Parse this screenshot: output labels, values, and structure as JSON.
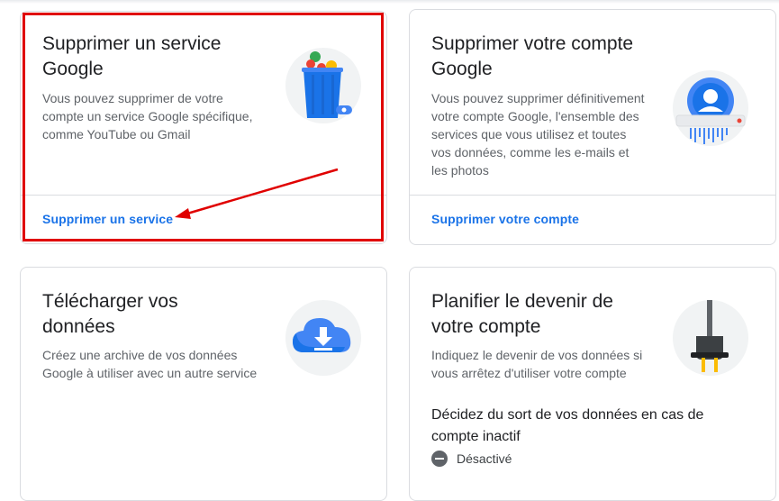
{
  "cards": {
    "delete_service": {
      "title_line1": "Supprimer un service",
      "title_line2": "Google",
      "desc_line1": "Vous pouvez supprimer de votre",
      "desc_line2": "compte un service Google spécifique,",
      "desc_line3": "comme YouTube ou Gmail",
      "link": "Supprimer un service",
      "icon": "trash-bin-icon"
    },
    "delete_account": {
      "title_line1": "Supprimer votre compte",
      "title_line2": "Google",
      "desc_line1": "Vous pouvez supprimer définitivement",
      "desc_line2": "votre compte Google, l'ensemble des",
      "desc_line3": "services que vous utilisez et toutes",
      "desc_line4": "vos données, comme les e-mails et",
      "desc_line5": "les photos",
      "link": "Supprimer votre compte",
      "icon": "account-shredder-icon"
    },
    "download_data": {
      "title_line1": "Télécharger vos",
      "title_line2": "données",
      "desc_line1": "Créez une archive de vos données",
      "desc_line2": "Google à utiliser avec un autre service",
      "icon": "cloud-download-icon"
    },
    "plan_account": {
      "title_line1": "Planifier le devenir de",
      "title_line2": "votre compte",
      "desc_line1": "Indiquez le devenir de vos données si",
      "desc_line2": "vous arrêtez d'utiliser votre compte",
      "sub_line1": "Décidez du sort de vos données en cas de",
      "sub_line2": "compte inactif",
      "status": "Désactivé",
      "icon": "power-plug-icon"
    }
  },
  "annotation": {
    "color": "#e00000"
  },
  "colors": {
    "link": "#1a73e8",
    "border": "#dadce0",
    "title": "#202124",
    "body": "#5f6368"
  }
}
